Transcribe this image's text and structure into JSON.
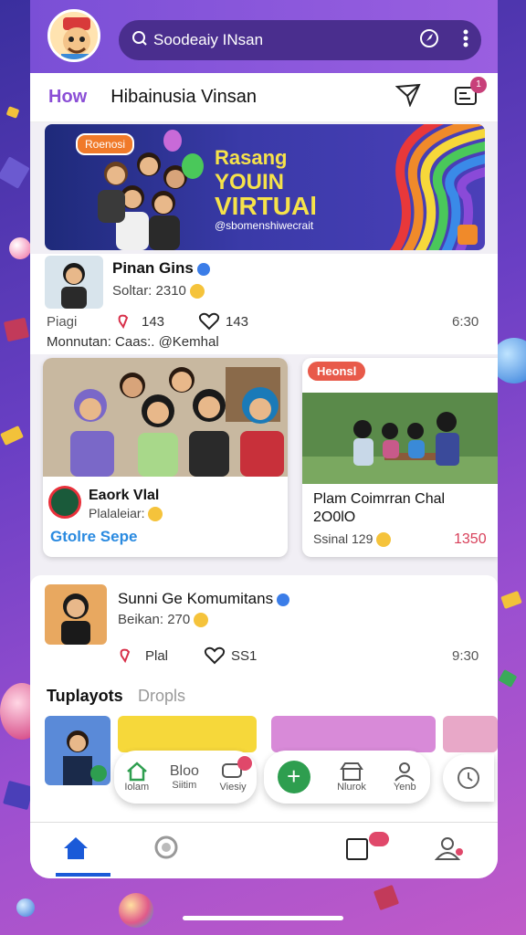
{
  "topbar": {
    "search_text": "Soodeaiy INsan",
    "avatar_icon": "mascot-avatar-icon"
  },
  "header": {
    "how_label": "How",
    "title": "Hibainusia Vinsan",
    "notification_count": "1"
  },
  "banner": {
    "tag": "Roenosi",
    "line1": "Rasang",
    "line2": "YOUIN",
    "line3": "VIRTUAl",
    "handle": "@sbomenshiwecrait"
  },
  "post1": {
    "name": "Pinan Gins",
    "subtitle": "Soltar: 2310",
    "label_left": "Piagi",
    "likes": "143",
    "comments": "143",
    "time": "6:30",
    "caption": "Monnutan: Caas:. @Kemhal"
  },
  "card_left": {
    "title": "Eaork Vlal",
    "subtitle": "Plalaleiar:",
    "link": "Gtolre Sepe"
  },
  "card_right": {
    "tag": "Heonsl",
    "title_line1": "Plam Coimrran Chal",
    "title_line2": "2O0lO",
    "subtitle": "Ssinal 129",
    "count": "1350"
  },
  "post2": {
    "name": "Sunni Ge Komumitans",
    "subtitle": "Beikan: 270",
    "label_left": "Plal",
    "comments": "SS1",
    "time": "9:30"
  },
  "section": {
    "tab_active": "Tuplayots",
    "tab_inactive": "Dropls"
  },
  "tray_left": {
    "items": [
      {
        "label": "Iolam",
        "icon": "home-icon"
      },
      {
        "label": "Siitim",
        "icon": "text-icon"
      },
      {
        "label": "Viesiy",
        "icon": "chat-icon"
      }
    ]
  },
  "tray_right": {
    "items": [
      {
        "label": "",
        "icon": "plus-icon"
      },
      {
        "label": "Nlurok",
        "icon": "store-icon"
      },
      {
        "label": "Yenb",
        "icon": "person-icon"
      }
    ]
  },
  "colors": {
    "accent": "#8b4fd6",
    "pink": "#e0486a",
    "green": "#2e9e4f"
  }
}
